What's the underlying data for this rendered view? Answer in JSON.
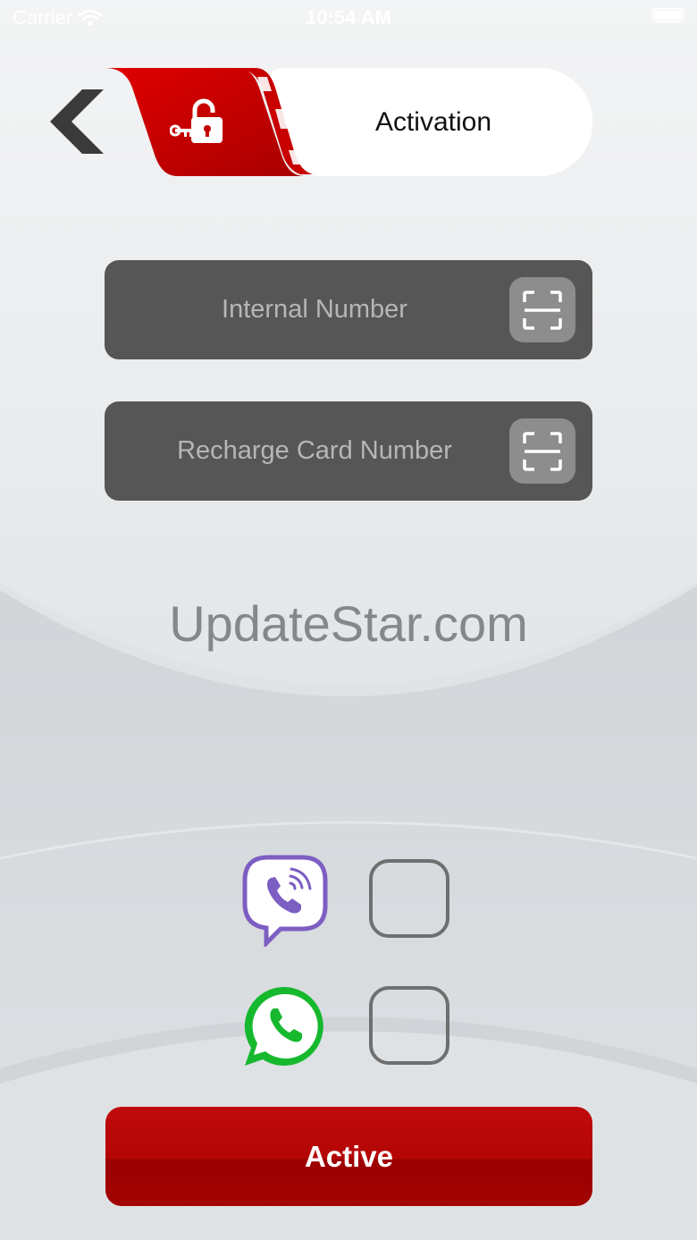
{
  "status_bar": {
    "carrier": "Carrier",
    "time": "10:54 AM"
  },
  "header": {
    "title": "Activation"
  },
  "form": {
    "internal_number": {
      "placeholder": "Internal Number",
      "value": ""
    },
    "recharge_card_number": {
      "placeholder": "Recharge Card Number",
      "value": ""
    }
  },
  "watermark": "UpdateStar.com",
  "contact_options": [
    {
      "app": "viber",
      "icon": "viber-icon",
      "checked": false,
      "color": "#7d5ec2"
    },
    {
      "app": "whatsapp",
      "icon": "whatsapp-icon",
      "checked": false,
      "color": "#16b92e"
    }
  ],
  "actions": {
    "active_label": "Active"
  },
  "colors": {
    "brand_red": "#c80000",
    "field_bg": "#565656",
    "scan_button_bg": "#8d8d8d"
  }
}
